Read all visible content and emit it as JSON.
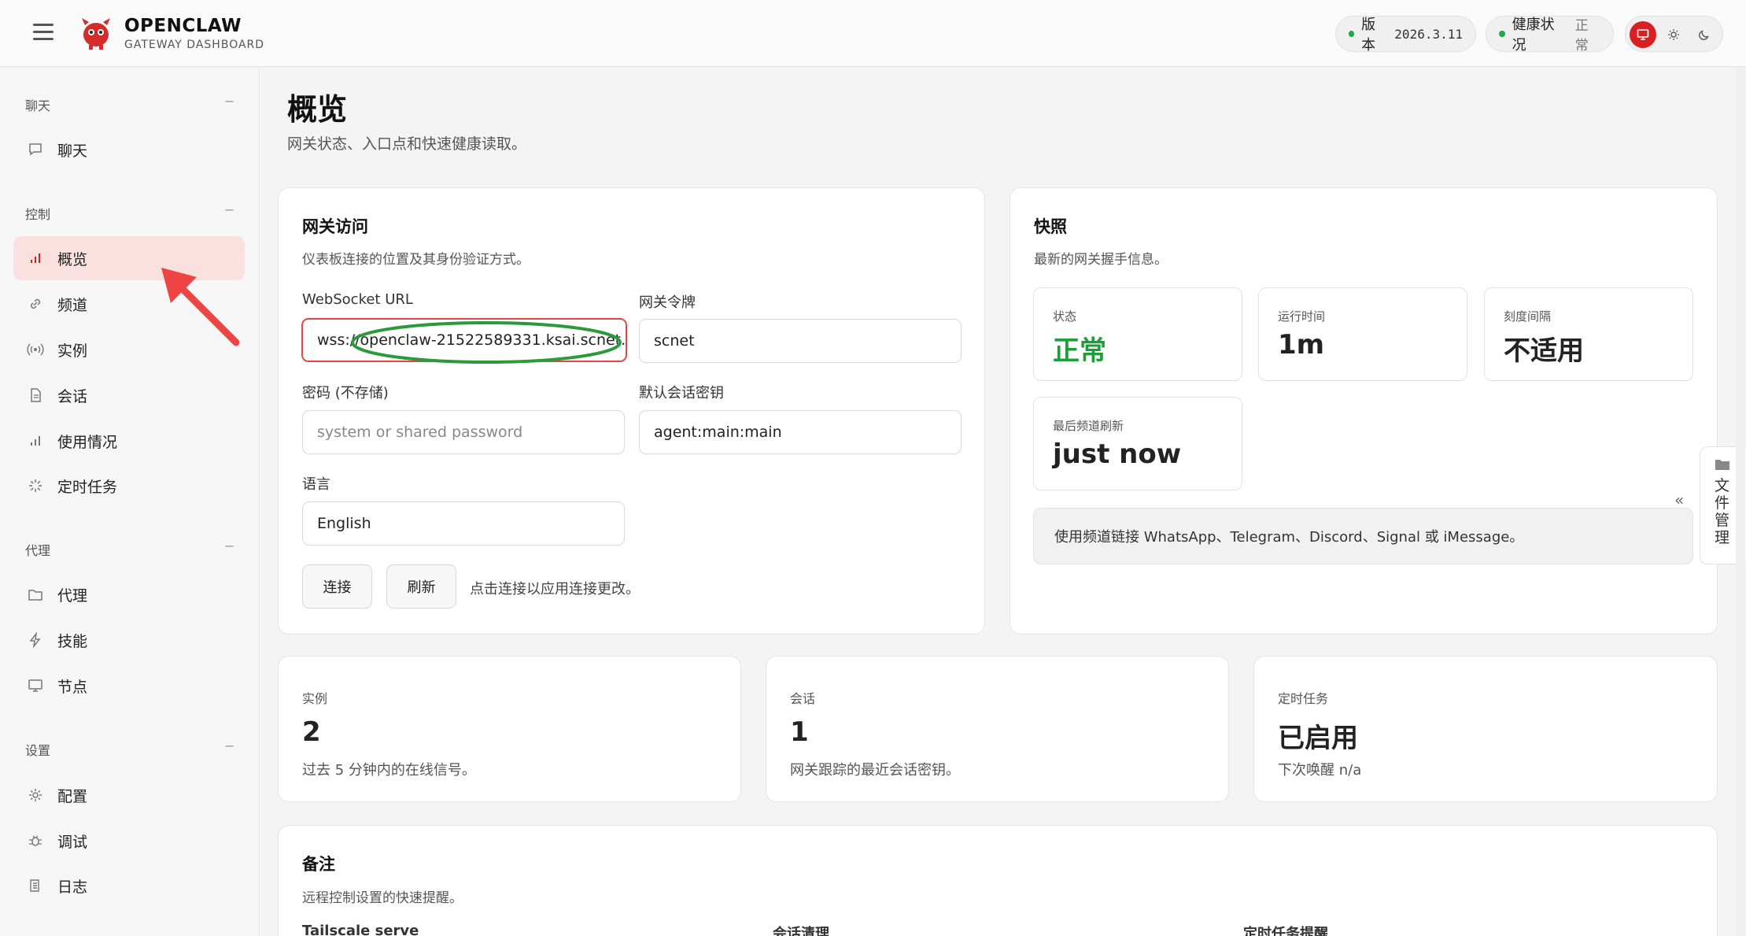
{
  "header": {
    "brand": "OPENCLAW",
    "subtitle": "GATEWAY DASHBOARD",
    "version_label": "版本",
    "version_value": "2026.3.11",
    "health_label": "健康状况",
    "health_value": "正常"
  },
  "sidebar": {
    "sections": [
      {
        "title": "聊天",
        "toggle": "−",
        "items": [
          {
            "label": "聊天",
            "icon": "chat-icon"
          }
        ]
      },
      {
        "title": "控制",
        "toggle": "−",
        "items": [
          {
            "label": "概览",
            "icon": "bar-chart-icon",
            "active": true
          },
          {
            "label": "频道",
            "icon": "link-icon"
          },
          {
            "label": "实例",
            "icon": "broadcast-icon"
          },
          {
            "label": "会话",
            "icon": "document-icon"
          },
          {
            "label": "使用情况",
            "icon": "bar-chart-icon"
          },
          {
            "label": "定时任务",
            "icon": "loader-icon"
          }
        ]
      },
      {
        "title": "代理",
        "toggle": "−",
        "items": [
          {
            "label": "代理",
            "icon": "folder-icon"
          },
          {
            "label": "技能",
            "icon": "lightning-icon"
          },
          {
            "label": "节点",
            "icon": "monitor-icon"
          }
        ]
      },
      {
        "title": "设置",
        "toggle": "−",
        "items": [
          {
            "label": "配置",
            "icon": "gear-icon"
          },
          {
            "label": "调试",
            "icon": "bug-icon"
          },
          {
            "label": "日志",
            "icon": "log-icon"
          }
        ]
      }
    ]
  },
  "page": {
    "title": "概览",
    "subtitle": "网关状态、入口点和快速健康读取。"
  },
  "gateway": {
    "title": "网关访问",
    "subtitle": "仪表板连接的位置及其身份验证方式。",
    "ws_label": "WebSocket URL",
    "ws_value": "wss://openclaw-21522589331.ksai.scnet.",
    "token_label": "网关令牌",
    "token_value": "scnet",
    "password_label": "密码 (不存储)",
    "password_placeholder": "system or shared password",
    "session_label": "默认会话密钥",
    "session_value": "agent:main:main",
    "lang_label": "语言",
    "lang_value": "English",
    "connect_btn": "连接",
    "refresh_btn": "刷新",
    "hint": "点击连接以应用连接更改。"
  },
  "snapshot": {
    "title": "快照",
    "subtitle": "最新的网关握手信息。",
    "stats": [
      {
        "label": "状态",
        "value": "正常"
      },
      {
        "label": "运行时间",
        "value": "1m"
      },
      {
        "label": "刻度间隔",
        "value": "不适用"
      },
      {
        "label": "最后频道刷新",
        "value": "just now"
      }
    ],
    "banner": "使用频道链接 WhatsApp、Telegram、Discord、Signal 或 iMessage。"
  },
  "bottom_cards": [
    {
      "label": "实例",
      "value": "2",
      "desc": "过去 5 分钟内的在线信号。"
    },
    {
      "label": "会话",
      "value": "1",
      "desc": "网关跟踪的最近会话密钥。"
    },
    {
      "label": "定时任务",
      "value": "已启用",
      "desc": "下次唤醒 n/a"
    }
  ],
  "notes": {
    "title": "备注",
    "subtitle": "远程控制设置的快速提醒。",
    "cols": [
      "Tailscale serve",
      "会话清理",
      "定时任务提醒"
    ]
  },
  "side_panel": {
    "label": "文件管理",
    "collapse": "«"
  },
  "colors": {
    "accent": "#d92020",
    "active_nav_bg": "#fbe0e0",
    "ok_green": "#1f9d3a",
    "annotation_red": "#e04848",
    "annotation_green": "#2a9a3a"
  }
}
